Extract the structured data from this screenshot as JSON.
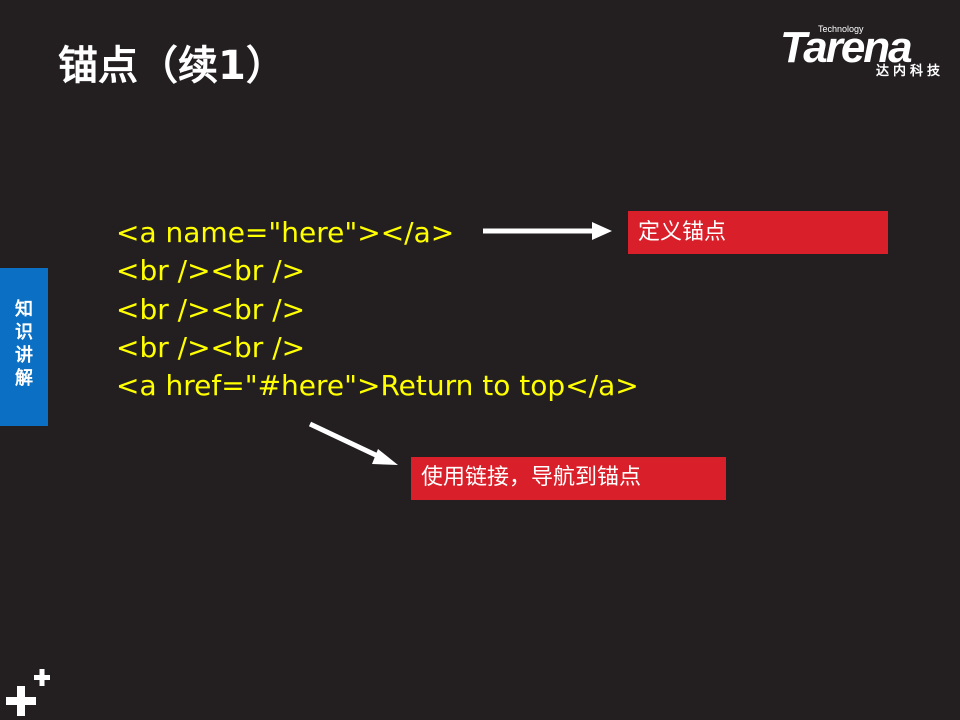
{
  "slide": {
    "title": "锚点（续1）",
    "logo": {
      "small_text": "Technology",
      "wordmark": "Tarena",
      "subtitle": "达内科技"
    },
    "side_tab": {
      "label": "知识讲解",
      "color": "#0b6fc4"
    },
    "code_lines": [
      "<a name=\"here\"></a>",
      "<br /><br />",
      "<br /><br />",
      "<br /><br />",
      "<a href=\"#here\">Return to top</a>"
    ],
    "callouts": {
      "define_anchor": "定义锚点",
      "link_to_anchor": "使用链接，导航到锚点"
    },
    "colors": {
      "background": "#231f20",
      "code_text": "#ffff00",
      "callout_bg": "#d9202a",
      "title_text": "#ffffff"
    },
    "icons": {
      "corner": "plus-icon",
      "arrows": "arrow-icon"
    }
  }
}
